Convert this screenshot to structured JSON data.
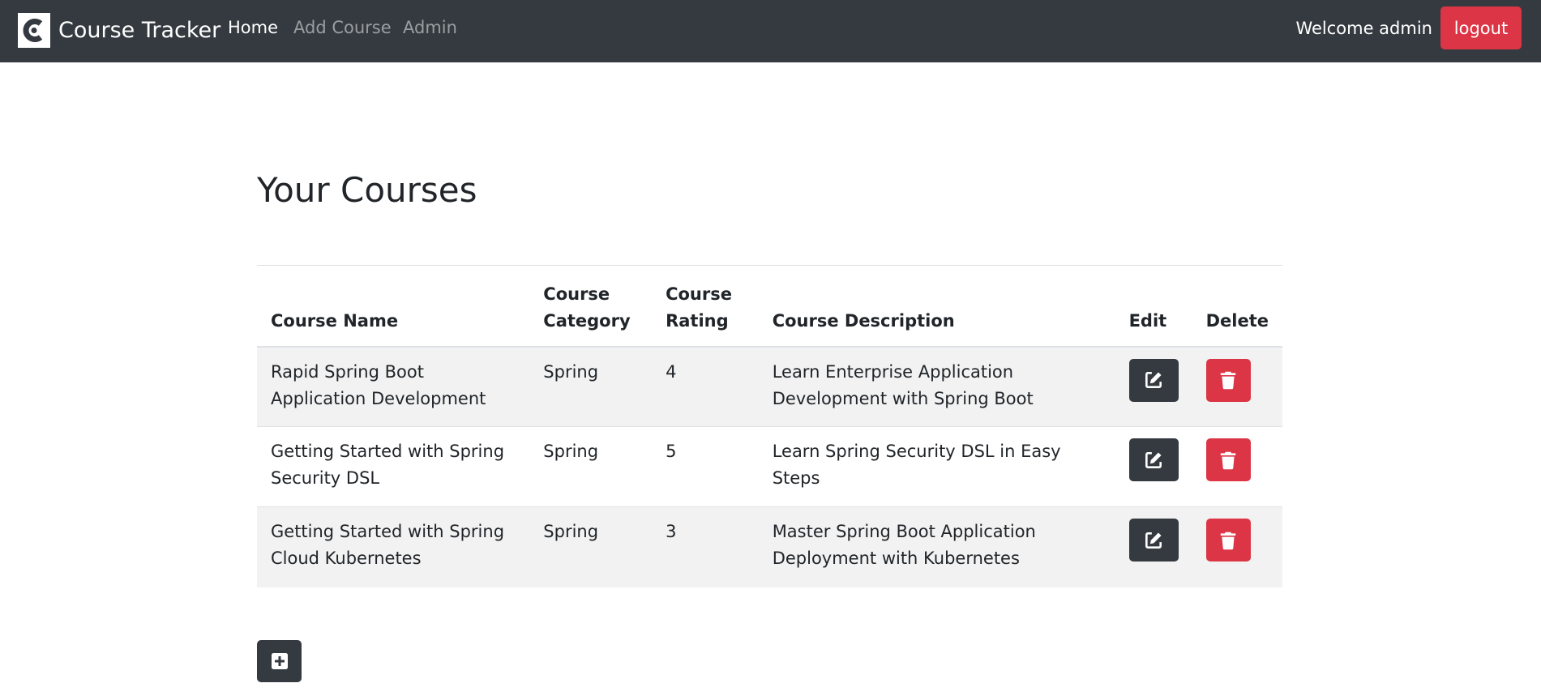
{
  "navbar": {
    "brand": "Course Tracker",
    "links": [
      {
        "label": "Home",
        "active": true
      },
      {
        "label": "Add Course",
        "active": false
      },
      {
        "label": "Admin",
        "active": false
      }
    ],
    "welcome": "Welcome admin",
    "logout_label": "logout"
  },
  "main": {
    "title": "Your Courses",
    "table": {
      "headers": {
        "name": "Course Name",
        "category": "Course Category",
        "rating": "Course Rating",
        "description": "Course Description",
        "edit": "Edit",
        "delete": "Delete"
      },
      "rows": [
        {
          "name": "Rapid Spring Boot Application Development",
          "category": "Spring",
          "rating": "4",
          "description": "Learn Enterprise Application Development with Spring Boot"
        },
        {
          "name": "Getting Started with Spring Security DSL",
          "category": "Spring",
          "rating": "5",
          "description": "Learn Spring Security DSL in Easy Steps"
        },
        {
          "name": "Getting Started with Spring Cloud Kubernetes",
          "category": "Spring",
          "rating": "3",
          "description": "Master Spring Boot Application Deployment with Kubernetes"
        }
      ]
    }
  },
  "icons": {
    "brand": "brand-logo-icon",
    "edit": "edit-icon",
    "delete": "trash-icon",
    "add": "plus-square-icon"
  },
  "colors": {
    "navbar": "#343a40",
    "danger": "#dc3545",
    "dark_button": "#343a40",
    "striped_row": "#f2f2f2"
  }
}
